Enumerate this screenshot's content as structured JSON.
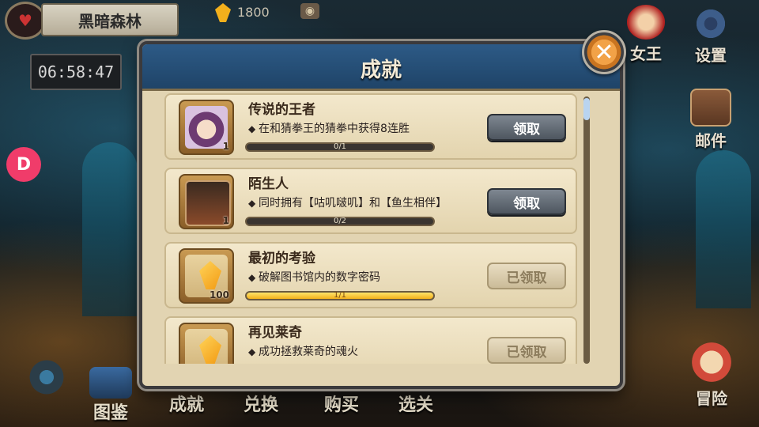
{
  "top": {
    "location": "黑暗森林",
    "gems": "1800",
    "timer": "06:58:47",
    "side_badge": "D"
  },
  "right_menu": {
    "king": "女王",
    "settings": "设置",
    "mail": "邮件",
    "adventure": "冒险"
  },
  "bottom_menu": {
    "codex": "图鉴",
    "achievements": "成就",
    "exchange": "兑换",
    "shop": "购买",
    "stage_select": "选关"
  },
  "dialog": {
    "title": "成就",
    "close_symbol": "✕"
  },
  "achievements": [
    {
      "title": "传说的王者",
      "desc": "在和猜拳王的猜拳中获得8连胜",
      "progress_text": "0/1",
      "progress": 0,
      "reward_qty": "1",
      "button": "领取",
      "state": "claim",
      "icon": "character-portrait"
    },
    {
      "title": "陌生人",
      "desc": "同时拥有【咕叽啵叽】和【鱼生相伴】",
      "progress_text": "0/2",
      "progress": 0,
      "reward_qty": "1",
      "button": "领取",
      "state": "claim",
      "icon": "card"
    },
    {
      "title": "最初的考验",
      "desc": "破解图书馆内的数字密码",
      "progress_text": "1/1",
      "progress": 1,
      "reward_qty": "100",
      "button": "已领取",
      "state": "claimed",
      "icon": "gem"
    },
    {
      "title": "再见莱奇",
      "desc": "成功拯救莱奇的魂火",
      "progress_text": "",
      "progress": 1,
      "reward_qty": "",
      "button": "已领取",
      "state": "claimed",
      "icon": "gem"
    }
  ],
  "colors": {
    "accent": "#f3b01c",
    "header": "#2d5a86",
    "claim_button": "#4e565f"
  }
}
